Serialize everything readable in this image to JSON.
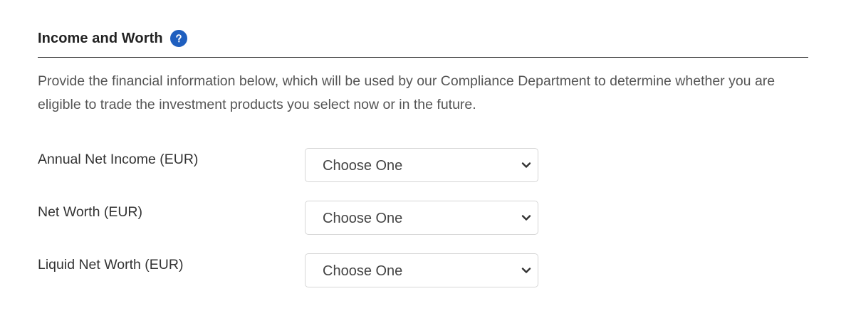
{
  "section": {
    "title": "Income and Worth",
    "help_icon": "question-mark-icon",
    "description": "Provide the financial information below, which will be used by our Compliance Department to determine whether you are eligible to trade the investment products you select now or in the future."
  },
  "fields": [
    {
      "label": "Annual Net Income (EUR)",
      "selected": "Choose One"
    },
    {
      "label": "Net Worth (EUR)",
      "selected": "Choose One"
    },
    {
      "label": "Liquid Net Worth (EUR)",
      "selected": "Choose One"
    }
  ],
  "colors": {
    "accent": "#1f5fbf",
    "divider": "#1a1a1a",
    "text": "#333333",
    "muted_text": "#555555",
    "select_border": "#d6d6d6"
  }
}
